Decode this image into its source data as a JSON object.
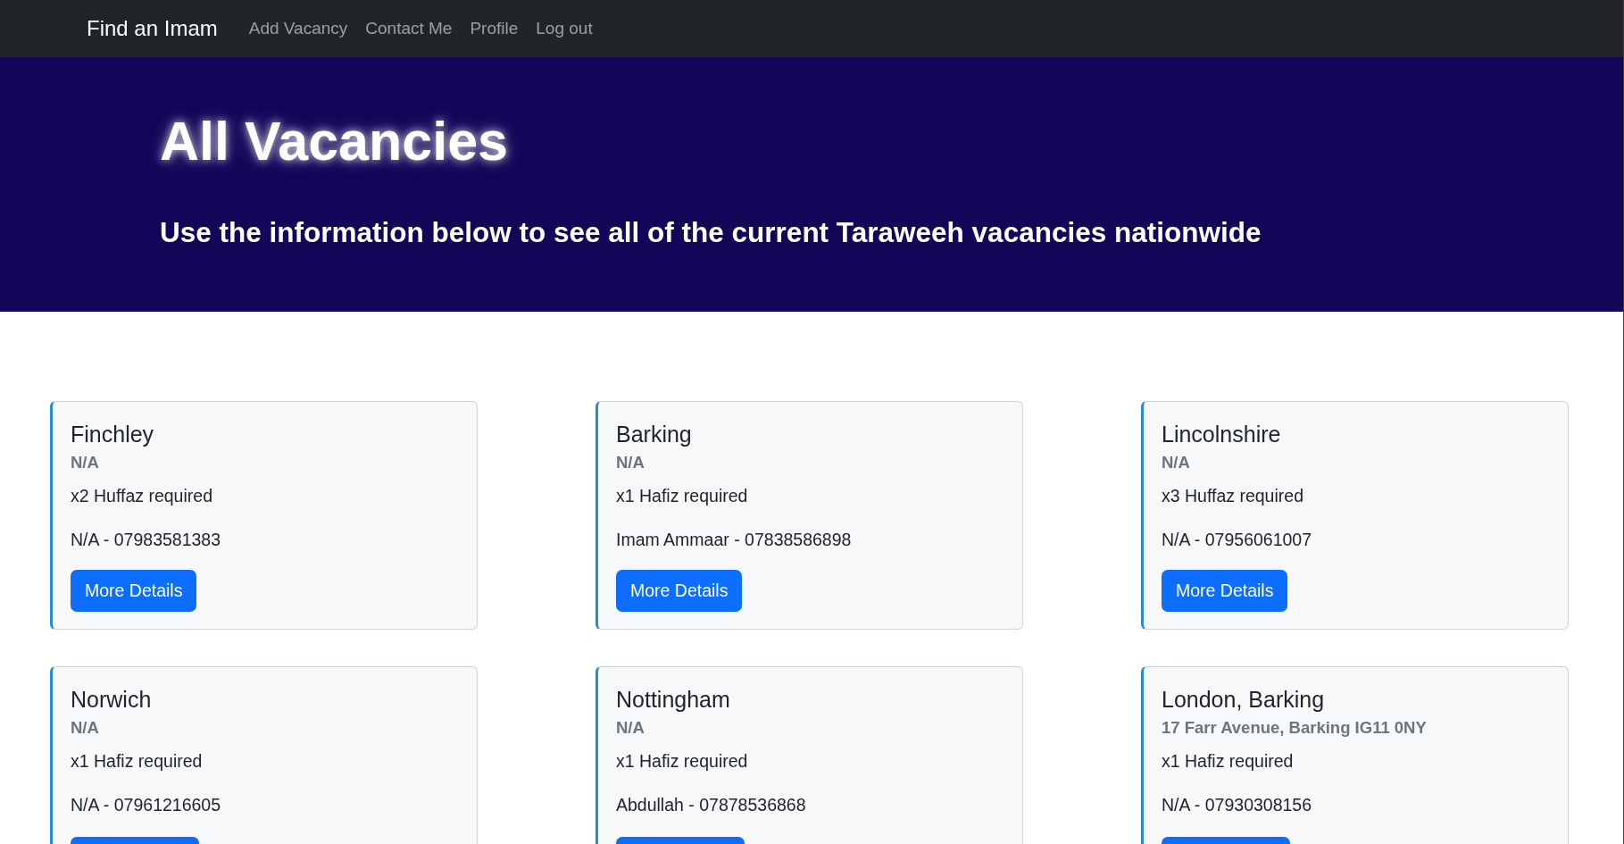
{
  "navbar": {
    "brand": "Find an Imam",
    "links": [
      {
        "label": "Add Vacancy"
      },
      {
        "label": "Contact Me"
      },
      {
        "label": "Profile"
      },
      {
        "label": "Log out"
      }
    ]
  },
  "hero": {
    "title": "All Vacancies",
    "subtitle": "Use the information below to see all of the current Taraweeh vacancies nationwide"
  },
  "vacancies": [
    {
      "location": "Finchley",
      "address": "N/A",
      "requirement": "x2 Huffaz required",
      "contact": "N/A - 07983581383",
      "button": "More Details"
    },
    {
      "location": "Barking",
      "address": "N/A",
      "requirement": "x1 Hafiz required",
      "contact": "Imam Ammaar - 07838586898",
      "button": "More Details"
    },
    {
      "location": "Lincolnshire",
      "address": "N/A",
      "requirement": "x3 Huffaz required",
      "contact": "N/A - 07956061007",
      "button": "More Details"
    },
    {
      "location": "Norwich",
      "address": "N/A",
      "requirement": "x1 Hafiz required",
      "contact": "N/A - 07961216605"
    },
    {
      "location": "Nottingham",
      "address": "N/A",
      "requirement": "x1 Hafiz required",
      "contact": "Abdullah - 07878536868"
    },
    {
      "location": "London, Barking",
      "address": "17 Farr Avenue, Barking IG11 0NY",
      "requirement": "x1 Hafiz required",
      "contact": "N/A - 07930308156"
    }
  ]
}
